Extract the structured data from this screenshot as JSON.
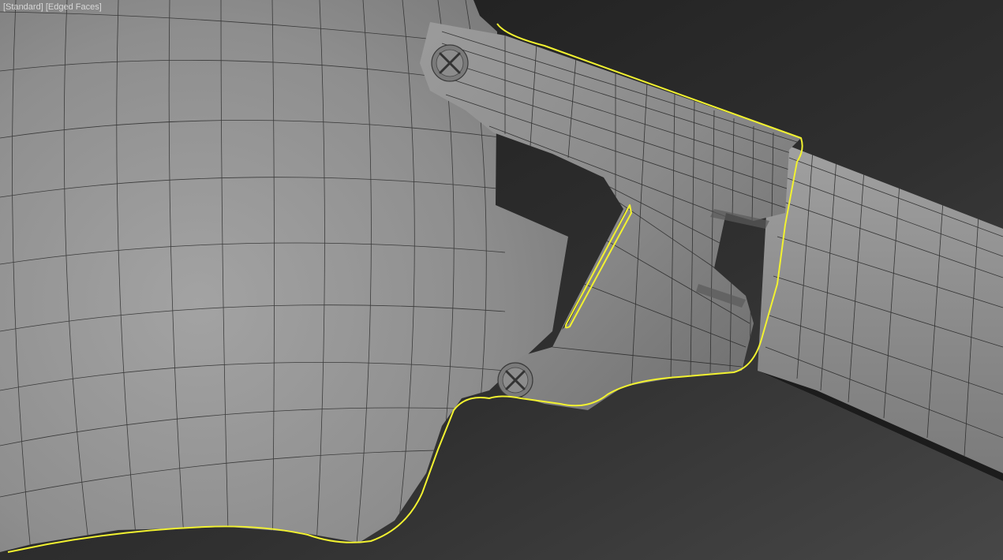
{
  "viewport": {
    "shading_mode_label": "[Standard]",
    "edged_faces_label": "[Edged Faces]"
  },
  "scene": {
    "object_icon": "mesh-object",
    "screw_icon": "screw-head",
    "colors": {
      "background": "#3f3f3f",
      "mesh_fill": "#8a8a8a",
      "mesh_fill_dark": "#6e6e6e",
      "wire": "#2a2a2a",
      "selection_outline": "#f2f230"
    }
  }
}
